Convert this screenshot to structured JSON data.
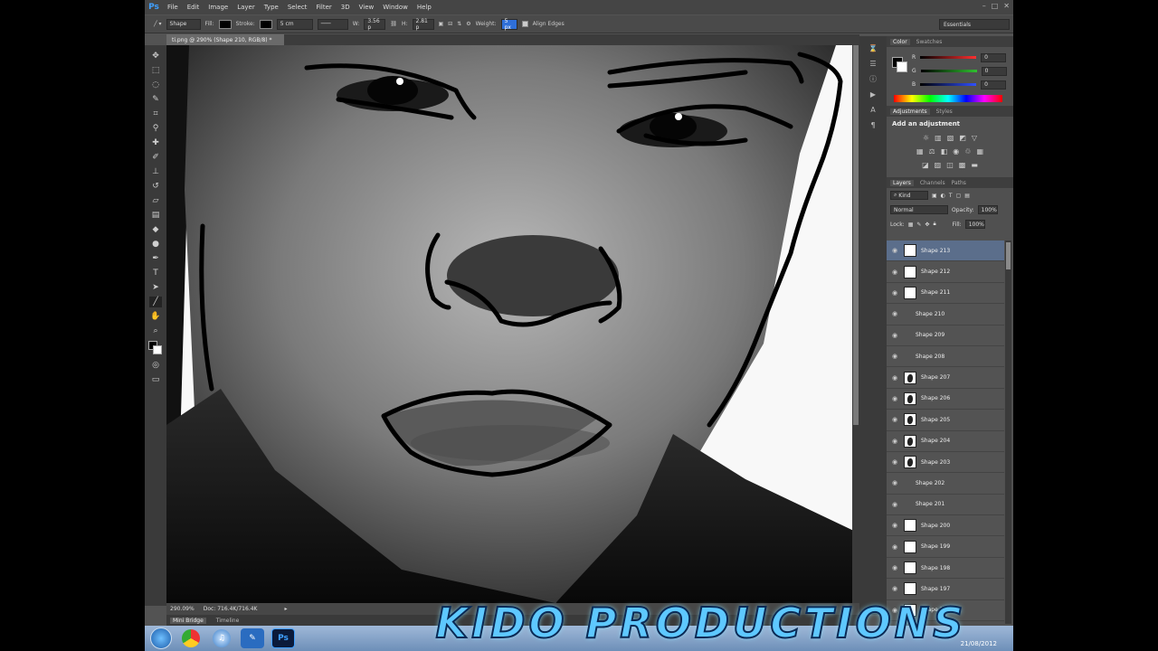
{
  "app": {
    "logo": "Ps"
  },
  "menu": [
    "File",
    "Edit",
    "Image",
    "Layer",
    "Type",
    "Select",
    "Filter",
    "3D",
    "View",
    "Window",
    "Help"
  ],
  "options": {
    "mode": "Shape",
    "fill_label": "Fill:",
    "stroke_label": "Stroke:",
    "stroke_size": "5 cm",
    "w_label": "W:",
    "w_value": "3.56 p",
    "h_label": "H:",
    "h_value": "2.81 p",
    "weight_label": "Weight:",
    "weight_value": "5 px",
    "align_label": "Align Edges",
    "workspace": "Essentials"
  },
  "document": {
    "tab_title": "ti.png @ 290% (Shape 210, RGB/8) *",
    "zoom": "290.09%",
    "doc_size": "Doc: 716.4K/716.4K"
  },
  "mini_bridge": {
    "tabs": [
      "Mini Bridge",
      "Timeline"
    ]
  },
  "color_panel": {
    "tabs": [
      "Color",
      "Swatches"
    ],
    "channels": [
      {
        "label": "R",
        "value": "0",
        "color": "#ff3030"
      },
      {
        "label": "G",
        "value": "0",
        "color": "#30c030"
      },
      {
        "label": "B",
        "value": "0",
        "color": "#3050ff"
      }
    ]
  },
  "adjustments_panel": {
    "tabs": [
      "Adjustments",
      "Styles"
    ],
    "title": "Add an adjustment"
  },
  "layers_panel": {
    "tabs": [
      "Layers",
      "Channels",
      "Paths"
    ],
    "kind": "Kind",
    "blend_mode": "Normal",
    "opacity_label": "Opacity:",
    "opacity": "100%",
    "lock_label": "Lock:",
    "fill_label": "Fill:",
    "fill": "100%",
    "layers": [
      {
        "name": "Shape 213",
        "thumb": "white",
        "selected": true
      },
      {
        "name": "Shape 212",
        "thumb": "white",
        "selected": false
      },
      {
        "name": "Shape 211",
        "thumb": "white",
        "selected": false
      },
      {
        "name": "Shape 210",
        "thumb": "empty",
        "selected": false
      },
      {
        "name": "Shape 209",
        "thumb": "empty",
        "selected": false
      },
      {
        "name": "Shape 208",
        "thumb": "empty",
        "selected": false
      },
      {
        "name": "Shape 207",
        "thumb": "dark",
        "selected": false
      },
      {
        "name": "Shape 206",
        "thumb": "dark",
        "selected": false
      },
      {
        "name": "Shape 205",
        "thumb": "dark",
        "selected": false
      },
      {
        "name": "Shape 204",
        "thumb": "dark",
        "selected": false
      },
      {
        "name": "Shape 203",
        "thumb": "dark",
        "selected": false
      },
      {
        "name": "Shape 202",
        "thumb": "empty",
        "selected": false
      },
      {
        "name": "Shape 201",
        "thumb": "empty",
        "selected": false
      },
      {
        "name": "Shape 200",
        "thumb": "white",
        "selected": false
      },
      {
        "name": "Shape 199",
        "thumb": "white",
        "selected": false
      },
      {
        "name": "Shape 198",
        "thumb": "white",
        "selected": false
      },
      {
        "name": "Shape 197",
        "thumb": "white",
        "selected": false
      },
      {
        "name": "Shape 196",
        "thumb": "white",
        "selected": false
      }
    ]
  },
  "taskbar": {
    "apps": [
      "start-orb",
      "chrome-icon",
      "itunes-icon",
      "paint-icon",
      "photoshop-icon"
    ],
    "date": "21/08/2012"
  },
  "watermark": "KIDO PRODUCTIONS"
}
